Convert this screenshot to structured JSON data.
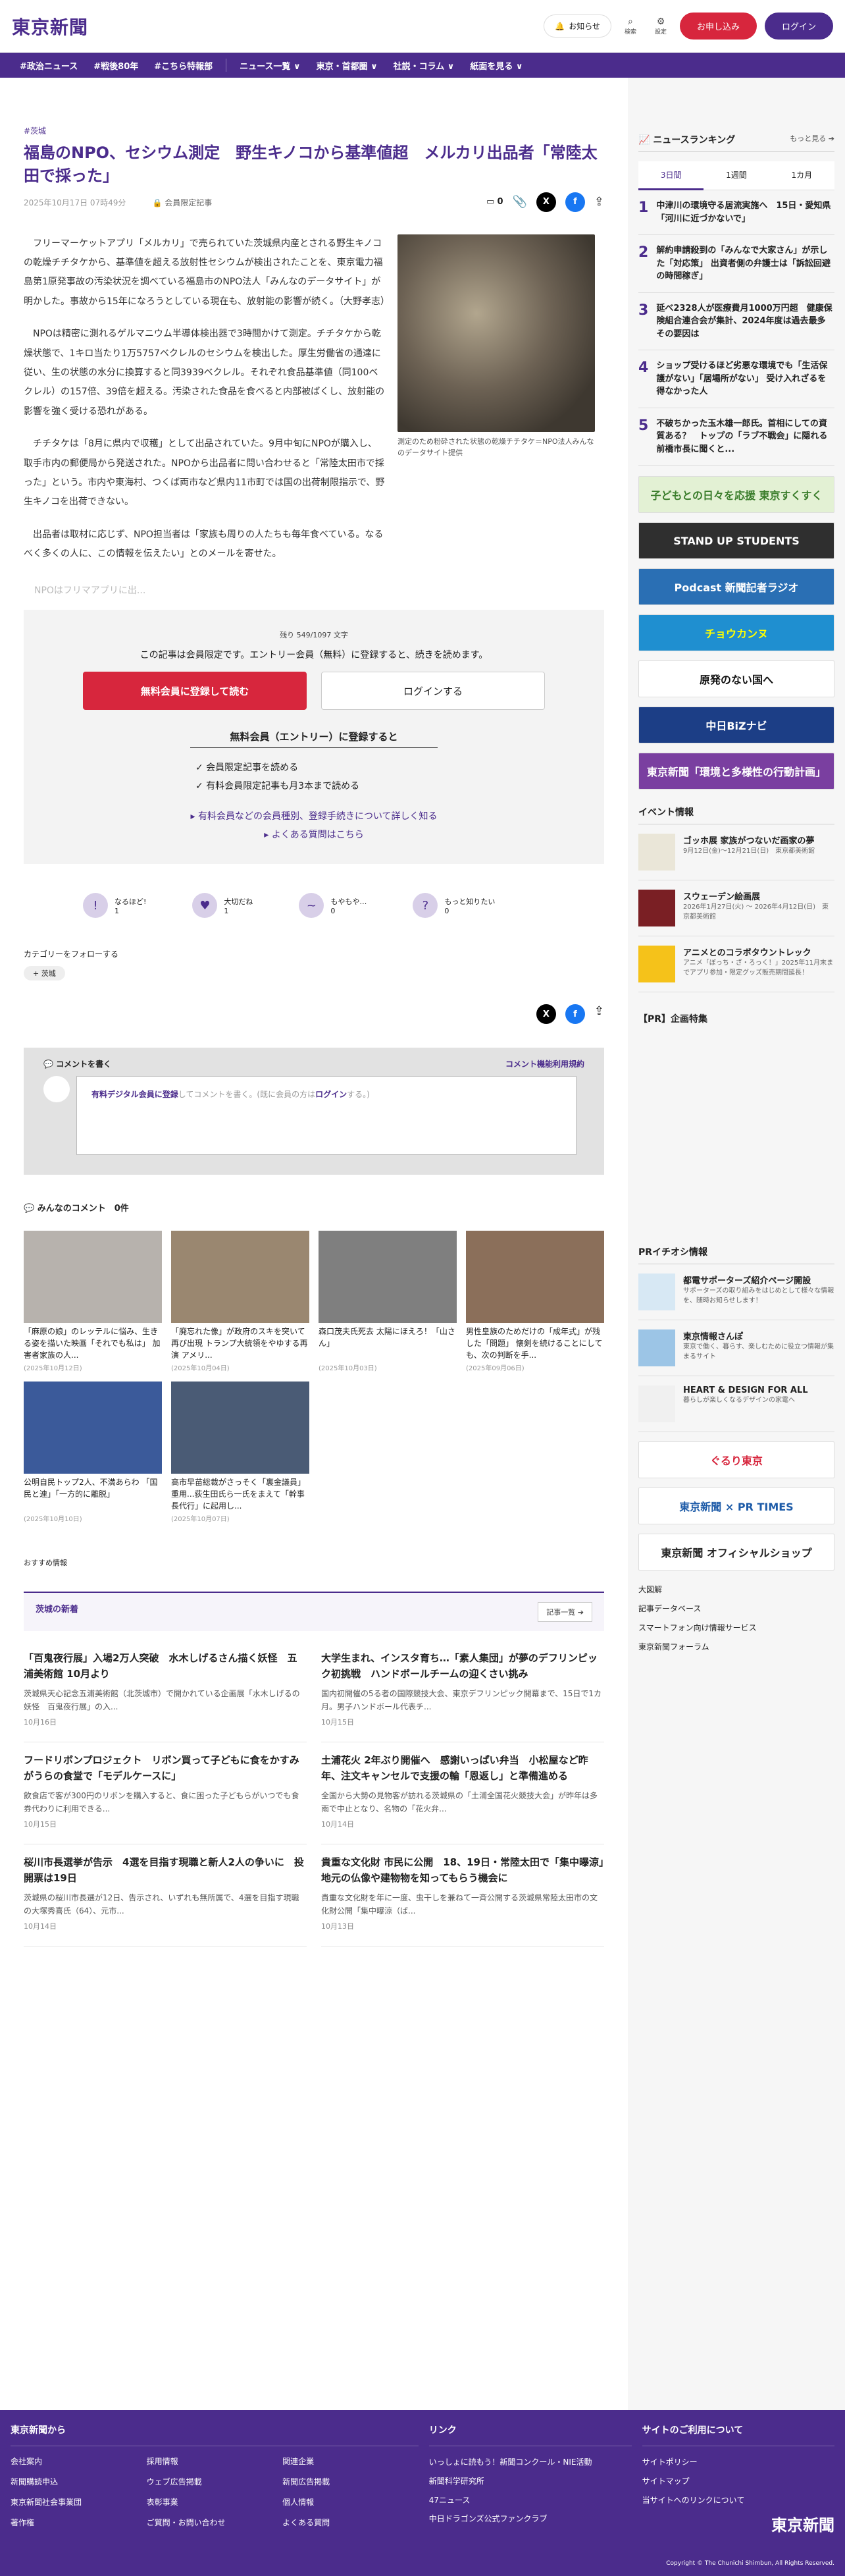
{
  "header": {
    "logo": "東京新聞",
    "notify": "お知らせ",
    "search": "検索",
    "settings": "設定",
    "subscribe": "お申し込み",
    "login": "ログイン"
  },
  "nav": {
    "items": [
      "#政治ニュース",
      "#戦後80年",
      "#こちら特報部"
    ],
    "menus": [
      "ニュース一覧 ∨",
      "東京・首都圏 ∨",
      "社説・コラム ∨",
      "紙面を見る ∨"
    ]
  },
  "article": {
    "category": "#茨城",
    "title": "福島のNPO、セシウム測定　野生キノコから基準値超　メルカリ出品者「常陸太田で採った」",
    "date": "2025年10月17日 07時49分",
    "members": "会員限定記事",
    "clip_count": "0",
    "paragraphs": [
      "フリーマーケットアプリ「メルカリ」で売られていた茨城県内産とされる野生キノコの乾燥チチタケから、基準値を超える放射性セシウムが検出されたことを、東京電力福島第1原発事故の汚染状況を調べている福島市のNPO法人「みんなのデータサイト」が明かした。事故から15年になろうとしている現在も、放射能の影響が続く。（大野孝志）",
      "NPOは精密に測れるゲルマニウム半導体検出器で3時間かけて測定。チチタケから乾燥状態で、1キロ当たり1万5757ベクレルのセシウムを検出した。厚生労働省の通達に従い、生の状態の水分に換算すると同3939ベクレル。それぞれ食品基準値（同100ベクレル）の157倍、39倍を超える。汚染された食品を食べると内部被ばくし、放射能の影響を強く受ける恐れがある。",
      "チチタケは「8月に県内で収穫」として出品されていた。9月中旬にNPOが購入し、取手市内の郵便局から発送された。NPOから出品者に問い合わせると「常陸太田市で採った」という。市内や東海村、つくば両市など県内11市町では国の出荷制限指示で、野生キノコを出荷できない。",
      "出品者は取材に応じず、NPO担当者は「家族も周りの人たちも毎年食べている。なるべく多くの人に、この情報を伝えたい」とのメールを寄せた。"
    ],
    "fade_text": "NPOはフリマアプリに出...",
    "caption": "測定のため粉砕された状態の乾燥チチタケ＝NPO法人みんなのデータサイト提供"
  },
  "paywall": {
    "count": "残り 549/1097 文字",
    "lead": "この記事は会員限定です。エントリー会員（無料）に登録すると、続きを読めます。",
    "register": "無料会員に登録して読む",
    "login": "ログインする",
    "benefit_title": "無料会員（エントリー）に登録すると",
    "benefits": [
      "✓ 会員限定記事を読める",
      "✓ 有料会員限定記事も月3本まで読める"
    ],
    "link1": "▸ 有料会員などの会員種別、登録手続きについて詳しく知る",
    "link2": "▸ よくある質問はこちら"
  },
  "reactions": [
    {
      "label": "なるほど!",
      "n": "1",
      "icon": "!"
    },
    {
      "label": "大切だね",
      "n": "1",
      "icon": "♥"
    },
    {
      "label": "もやもや…",
      "n": "0",
      "icon": "~"
    },
    {
      "label": "もっと知りたい",
      "n": "0",
      "icon": "?"
    }
  ],
  "follow": {
    "title": "カテゴリーをフォローする",
    "chip": "+ 茨城"
  },
  "comment": {
    "title": "コメントを書く",
    "terms": "コメント機能利用規約",
    "placeholder_link": "有料デジタル会員に登録",
    "placeholder_mid": "してコメントを書く。(既に会員の方は",
    "placeholder_login": "ログイン",
    "placeholder_end": "する。)"
  },
  "everyone": {
    "title": "みんなのコメント",
    "count": "0件"
  },
  "cards": [
    {
      "t": "「麻原の娘」のレッテルに悩み、生きる姿を描いた映画「それでも私は」 加害者家族の人...",
      "d": "(2025年10月12日)",
      "c": "#b7b2ad"
    },
    {
      "t": "「廃忘れた像」が政府のスキを突いて再び出現 トランプ大統領をやゆする再演 アメリ...",
      "d": "(2025年10月04日)",
      "c": "#9a8770"
    },
    {
      "t": "森口茂夫氏死去 太陽にほえろ！「山さん」",
      "d": "(2025年10月03日)",
      "c": "#7f7f7f"
    },
    {
      "t": "男性皇族のためだけの「成年式」が残した「問題」 懐剣を続けることにしても、次の判断を手...",
      "d": "(2025年09月06日)",
      "c": "#8b6f5a"
    },
    {
      "t": "公明自民トップ2人、不満あらわ 「国民と連」「一方的に離脱」",
      "d": "(2025年10月10日)",
      "c": "#3b5a9a"
    },
    {
      "t": "高市早苗総裁がさっそく「裏金議員」重用...荻生田氏ら一氏をまえて「幹事長代行」に起用し...",
      "d": "(2025年10月07日)",
      "c": "#4a5b75"
    }
  ],
  "recommend": "おすすめ情報",
  "ibaraki": {
    "title": "茨城の新着",
    "more": "記事一覧 ➔",
    "items": [
      {
        "h": "「百鬼夜行展」入場2万人突破　水木しげるさん描く妖怪　五浦美術館 10月より",
        "p": "茨城県天心記念五浦美術館（北茨城市）で開かれている企画展「水木しげるの妖怪　百鬼夜行展」の入...",
        "d": "10月16日"
      },
      {
        "h": "大学生まれ、インスタ育ち…「素人集団」が夢のデフリンピック初挑戦　ハンドボールチームの迎くさい挑み",
        "p": "国内初開催の5る者の国際競技大会、東京デフリンピック開幕まで、15日で1カ月。男子ハンドボール代表チ...",
        "d": "10月15日"
      },
      {
        "h": "フードリボンプロジェクト　リボン買って子どもに食をかすみがうらの食堂で「モデルケースに」",
        "p": "飲食店で客が300円のリボンを購入すると、食に困った子どもらがいつでも食券代わりに利用できる...",
        "d": "10月15日"
      },
      {
        "h": "土浦花火 2年ぶり開催へ　感謝いっぱい弁当　小松屋など昨年、注文キャンセルで支援の輪「恩返し」と準備進める",
        "p": "全国から大勢の見物客が訪れる茨城県の「土浦全国花火競技大会」が昨年は多雨で中止となり、名物の「花火弁...",
        "d": "10月14日"
      },
      {
        "h": "桜川市長選挙が告示　4選を目指す現職と新人2人の争いに　投開票は19日",
        "p": "茨城県の桜川市長選が12日、告示され、いずれも無所属で、4選を目指す現職の大塚秀喜氏（64）、元市...",
        "d": "10月14日"
      },
      {
        "h": "貴重な文化財 市民に公開　18、19日・常陸太田で「集中曝涼」　地元の仏像や建物物を知ってもらう機会に",
        "p": "貴重な文化財を年に一度、虫干しを兼ねて一斉公開する茨城県常陸太田市の文化財公開「集中曝涼（ば...",
        "d": "10月13日"
      }
    ]
  },
  "side": {
    "ranking_title": "ニュースランキング",
    "more": "もっと見る ➔",
    "tabs": [
      "3日間",
      "1週間",
      "1カ月"
    ],
    "ranks": [
      "中津川の環境守る居流実施へ　15日・愛知県「河川に近づかないで」",
      "解約申請殺到の「みんなで大家さん」が示した「対応策」 出資者側の弁護士は「訴訟回避の時間稼ぎ」",
      "延べ2328人が医療費月1000万円超　健康保険組合連合会が集計、2024年度は過去最多　その要因は",
      "ショップ受けるほど劣悪な環境でも「生活保護がない」「居場所がない」 受け入れざるを得なかった人",
      "不破ちかった玉木雄一郎氏。首相にしての資質ある？　トップの「ラブ不戦会」に隠れる前橋市長に聞くと..."
    ],
    "banners": [
      {
        "t": "子どもとの日々を応援 東京すくすく",
        "bg": "#e3f1d4",
        "c": "#3a7d2b"
      },
      {
        "t": "STAND UP STUDENTS",
        "bg": "#2f2f2f",
        "c": "#fff"
      },
      {
        "t": "Podcast 新聞記者ラジオ",
        "bg": "#2a6fb4",
        "c": "#fff"
      },
      {
        "t": "チョウカンヌ",
        "bg": "#1f8fd0",
        "c": "#ff0"
      },
      {
        "t": "原発のない国へ",
        "bg": "#fff",
        "c": "#111"
      },
      {
        "t": "中日BiZナビ",
        "bg": "#1c3e86",
        "c": "#fff"
      },
      {
        "t": "東京新聞「環境と多様性の行動計画」",
        "bg": "#7a3fa0",
        "c": "#fff"
      }
    ],
    "events_title": "イベント情報",
    "events": [
      {
        "t": "ゴッホ展 家族がつないだ画家の夢",
        "d": "9月12日(金)～12月21日(日)　東京都美術館",
        "bg": "#eae6d8"
      },
      {
        "t": "スウェーデン絵画展",
        "d": "2026年1月27日(火) ～ 2026年4月12日(日)　東京都美術館",
        "bg": "#7a1f24"
      },
      {
        "t": "アニメとのコラボタウントレック",
        "d": "アニメ「ぼっち・ざ・ろっく！」2025年11月末までアプリ参加・限定グッズ販売期間延長！",
        "bg": "#f5c21a"
      }
    ],
    "pr_title": "【PR】企画特集",
    "pr_info_title": "PRイチオシ情報",
    "pr_info": [
      {
        "t": "都電サポーターズ紹介ページ開設",
        "d": "サポーターズの取り組みをはじめとして様々な情報を、随時お知らせします！",
        "bg": "#d7e8f4"
      },
      {
        "t": "東京情報さんぽ",
        "d": "東京で働く、暮らす、楽しむために役立つ情報が集まるサイト",
        "bg": "#9cc5e6"
      },
      {
        "t": "HEART & DESIGN FOR ALL",
        "d": "暮らしが楽しくなるデザインの家電へ",
        "bg": "#f0f0f0"
      }
    ],
    "bottom_banners": [
      {
        "t": "ぐるり東京",
        "bg": "#fff",
        "c": "#d7263d"
      },
      {
        "t": "東京新聞 × PR TIMES",
        "bg": "#fff",
        "c": "#1d5ba8"
      },
      {
        "t": "東京新聞 オフィシャルショップ",
        "bg": "#fff",
        "c": "#222"
      }
    ],
    "links": [
      "大図解",
      "記事データベース",
      "スマートフォン向け情報サービス",
      "東京新聞フォーラム"
    ]
  },
  "footer": {
    "from": "東京新聞から",
    "from_links": [
      "会社案内",
      "採用情報",
      "関連企業",
      "新聞購読申込",
      "ウェブ広告掲載",
      "新聞広告掲載",
      "東京新聞社会事業団",
      "表彰事業",
      "個人情報",
      "著作権",
      "ご質問・お問い合わせ",
      "よくある質問"
    ],
    "link": "リンク",
    "link_items": [
      "いっしょに読もう！新聞コンクール・NIE活動",
      "新聞科学研究所",
      "47ニュース",
      "中日ドラゴンズ公式ファンクラブ"
    ],
    "site": "サイトのご利用について",
    "site_items": [
      "サイトポリシー",
      "サイトマップ",
      "当サイトへのリンクについて"
    ],
    "logo": "東京新聞",
    "copyright": "Copyright © The Chunichi Shimbun, All Rights Reserved."
  }
}
